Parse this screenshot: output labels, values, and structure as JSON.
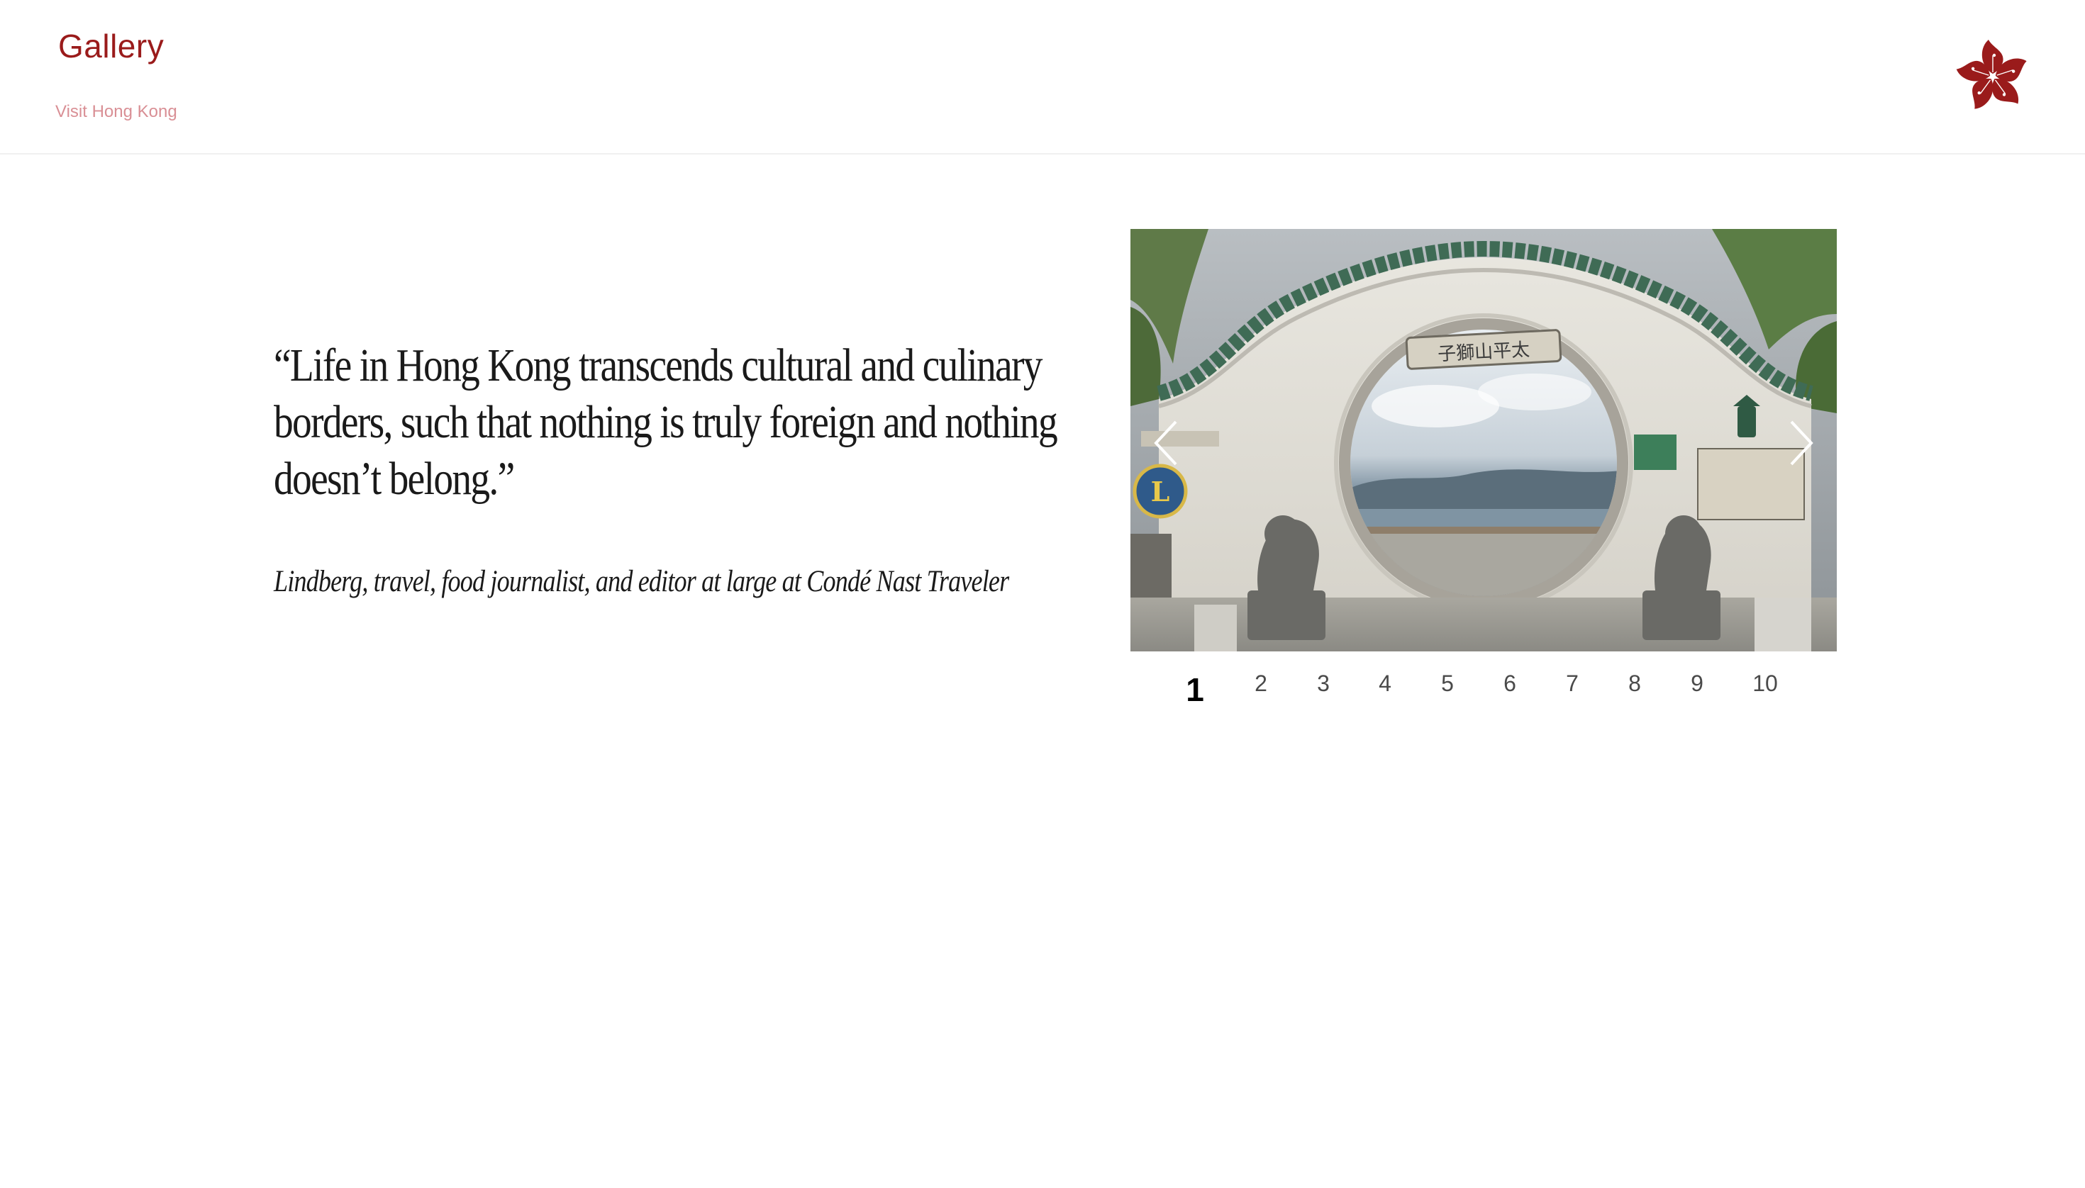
{
  "header": {
    "title": "Gallery",
    "subtitle": "Visit Hong Kong",
    "logo": "bauhinia-flower-icon",
    "brand_color": "#9a1b1b",
    "subtitle_color": "#d98f95"
  },
  "quote": {
    "text": "“Life in Hong Kong transcends cultural and culinary borders, such that nothing is truly foreign and nothing doesn’t belong.”",
    "attribution": "Lindberg, travel, food journalist, and editor at large at Condé Nast Traveler"
  },
  "carousel": {
    "image": "moon-gate-photo",
    "prev_icon": "chevron-left-icon",
    "next_icon": "chevron-right-icon",
    "gate_inscription": "子獅山平太",
    "current_page": "1",
    "pages": [
      "1",
      "2",
      "3",
      "4",
      "5",
      "6",
      "7",
      "8",
      "9",
      "10"
    ]
  }
}
